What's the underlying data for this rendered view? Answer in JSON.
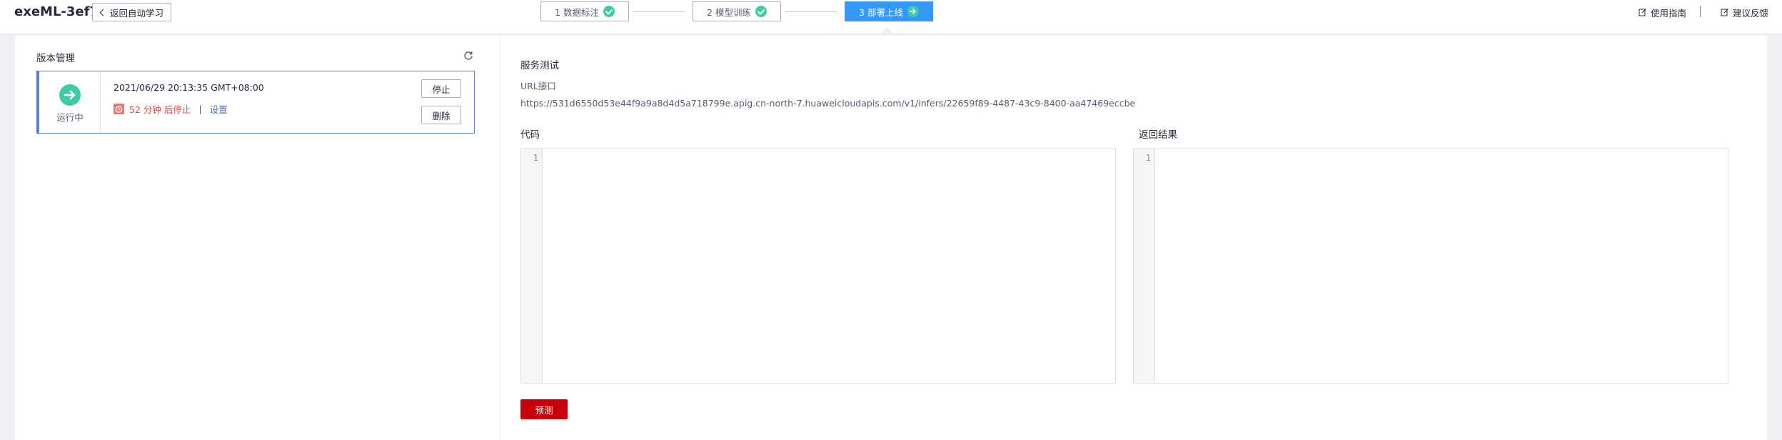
{
  "header": {
    "app_title": "exeML-3ef7",
    "back_label": "返回自动学习",
    "steps": [
      {
        "label": "1 数据标注"
      },
      {
        "label": "2 模型训练"
      },
      {
        "label": "3 部署上线"
      }
    ],
    "guide_label": "使用指南",
    "feedback_label": "建议反馈"
  },
  "version_panel": {
    "title": "版本管理",
    "card": {
      "status": "运行中",
      "time": "2021/06/29 20:13:35 GMT+08:00",
      "stop_countdown": "52 分钟 后停止",
      "separator": "|",
      "settings_label": "设置",
      "stop_button": "停止",
      "delete_button": "删除"
    }
  },
  "service_test": {
    "title": "服务测试",
    "url_label": "URL接口",
    "url": "https://531d6550d53e44f9a9a8d4d5a718799e.apig.cn-north-7.huaweicloudapis.com/v1/infers/22659f89-4487-43c9-8400-aa47469eccbe",
    "code_label": "代码",
    "result_label": "返回结果",
    "code_line_no": "1",
    "result_line_no": "1",
    "predict_button": "预测"
  },
  "colors": {
    "accent": "#5e7ce0",
    "step_active": "#3399ff",
    "success": "#3dcca6",
    "danger": "#e54545",
    "primary_button": "#c7000b"
  }
}
